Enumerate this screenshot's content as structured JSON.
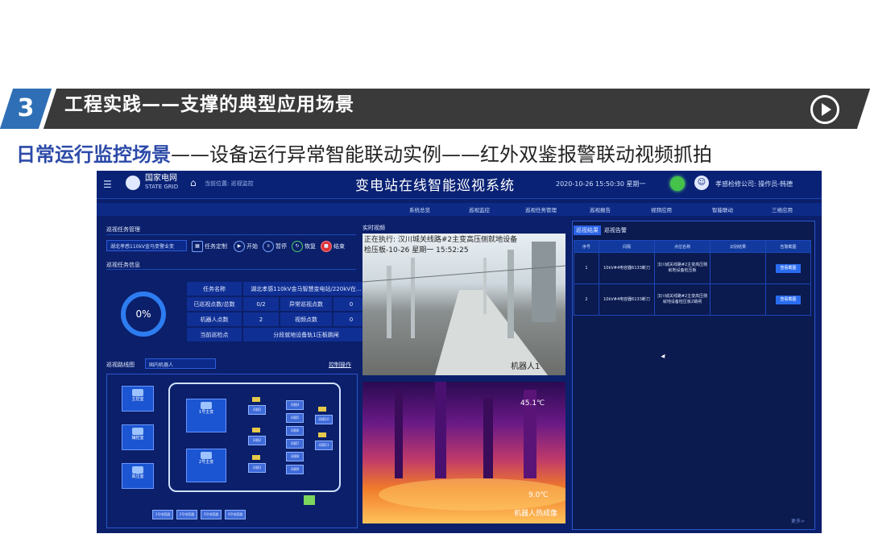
{
  "slide": {
    "section_number": "3",
    "banner_title": "工程实践——支撑的典型应用场景",
    "subtitle_bold": "日常运行监控场景",
    "subtitle_rest": "——设备运行异常智能联动实例——红外双鉴报警联动视频抓拍"
  },
  "app": {
    "brand_cn": "国家电网",
    "brand_en": "STATE GRID",
    "breadcrumb": "当前位置: 巡视监控",
    "title": "变电站在线智能巡视系统",
    "datetime": "2020-10-26 15:50:30  星期一",
    "user": "孝感检修公司: 操作员-韩德",
    "nav": [
      "系统总览",
      "巡视监控",
      "巡视任务管理",
      "巡视报告",
      "视频应用",
      "智能联动",
      "三维应用"
    ]
  },
  "task": {
    "section": "巡视任务管理",
    "station_select": "湖北孝感110kV金马变警业变",
    "controls": [
      "任务定制",
      "开始",
      "暂停",
      "恢复",
      "结束"
    ],
    "info_section": "巡视任务信息",
    "progress": "0%",
    "rows": [
      [
        "任务名称",
        "湖北孝感110kV金马智慧变电站/220kV在..."
      ],
      [
        "已巡视点数/总数",
        "0/2",
        "异常巡视点数",
        "0"
      ],
      [
        "机器人点数",
        "2",
        "视频点数",
        "0"
      ],
      [
        "当前巡检点",
        "分段就地设备轨1压板跳闸"
      ]
    ]
  },
  "route": {
    "section": "巡视路线图",
    "robot_select": "国内机器人",
    "control_link": "控制操作",
    "rooms": [
      "主控室",
      "辅控室",
      "高压室",
      "1号主变",
      "2号主变"
    ],
    "cabinets": [
      "间隔1",
      "间隔2",
      "间隔3",
      "间隔4",
      "间隔5",
      "间隔6",
      "间隔7",
      "间隔8",
      "间隔9",
      "间隔10",
      "间隔11"
    ],
    "bottom": [
      "1号电容器",
      "2号电容器",
      "3号电容器",
      "4号电容器"
    ]
  },
  "video": {
    "section": "实时视频",
    "overlay_line1": "正在执行: 汉川城关线路#2主变高压侧就地设备",
    "overlay_line2": "检压板-10-26  星期一  15:52:25",
    "cam1_label": "机器人1",
    "temp_max": "45.1℃",
    "temp_min": "9.0℃",
    "cam2_label": "机器人热成像"
  },
  "alarm": {
    "tabs": [
      "巡视结果",
      "巡视告警"
    ],
    "headers": [
      "序号",
      "间隔",
      "点位名称",
      "识别结果",
      "告警截图"
    ],
    "rows": [
      [
        "1",
        "10kV#4电容器6133断刀",
        "汉川城关线路#2主变高压侧就地设备检压板",
        "",
        "查看截图"
      ],
      [
        "2",
        "10kV#4电容器6133断刀",
        "汉川城关线路#2主变高压侧就地设备检压板2跳闸",
        "",
        "查看截图"
      ]
    ],
    "more": "更多>"
  }
}
